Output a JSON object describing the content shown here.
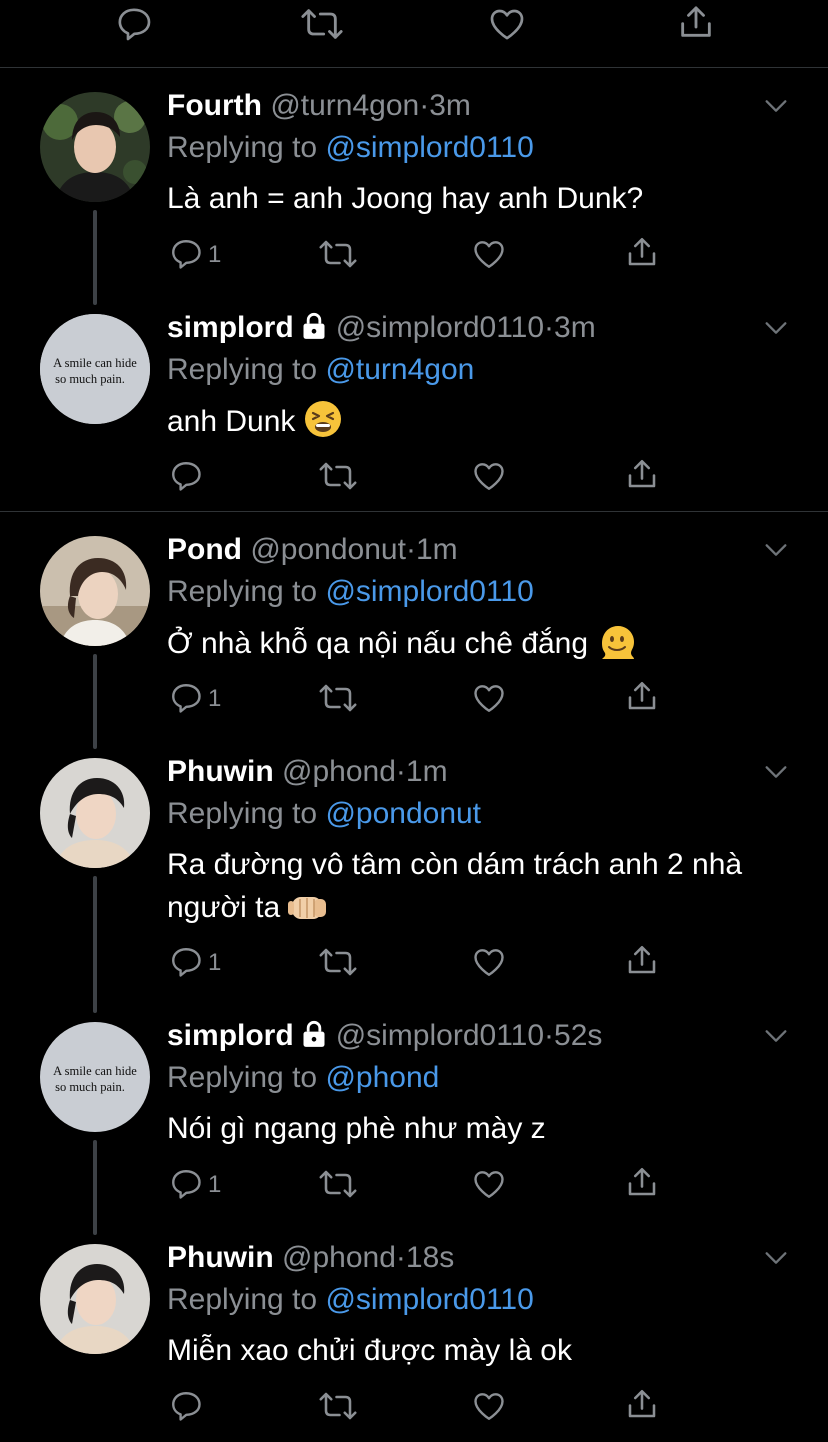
{
  "top_actions": [
    "reply-icon",
    "retweet-icon",
    "like-icon",
    "share-icon"
  ],
  "reply_prefix": "Replying to",
  "dot": "·",
  "colors": {
    "background": "#000000",
    "mention": "#4a99e9",
    "secondary_text": "#8b8f94",
    "divider": "#2f3336"
  },
  "avatar_quote": {
    "line1": "A smile can hide",
    "line2": "so much pain."
  },
  "tweets": [
    {
      "name": "Fourth",
      "handle": "@turn4gon",
      "time": "3m",
      "reply_to": "@simplord0110",
      "text": "Là anh = anh Joong hay anh Dunk?",
      "reply_count": "1",
      "locked": false
    },
    {
      "name": "simplord",
      "handle": "@simplord0110",
      "time": "3m",
      "reply_to": "@turn4gon",
      "text": "anh Dunk",
      "emoji": "tired-face-emoji",
      "reply_count": "",
      "locked": true
    },
    {
      "name": "Pond",
      "handle": "@pondonut",
      "time": "1m",
      "reply_to": "@simplord0110",
      "text": "Ở nhà khỗ qa nội nấu chê đắng",
      "emoji": "melting-face-emoji",
      "reply_count": "1",
      "locked": false
    },
    {
      "name": "Phuwin",
      "handle": "@phond",
      "time": "1m",
      "reply_to": "@pondonut",
      "text_line1": "Ra đường vô tâm còn dám trách anh 2 nhà",
      "text_line2": "người ta",
      "emoji": "fist-emoji",
      "reply_count": "1",
      "locked": false
    },
    {
      "name": "simplord",
      "handle": "@simplord0110",
      "time": "52s",
      "reply_to": "@phond",
      "text": "Nói gì ngang phè như mày z",
      "reply_count": "1",
      "locked": true
    },
    {
      "name": "Phuwin",
      "handle": "@phond",
      "time": "18s",
      "reply_to": "@simplord0110",
      "text": "Miễn xao chửi được mày là ok",
      "reply_count": "",
      "locked": false
    }
  ]
}
